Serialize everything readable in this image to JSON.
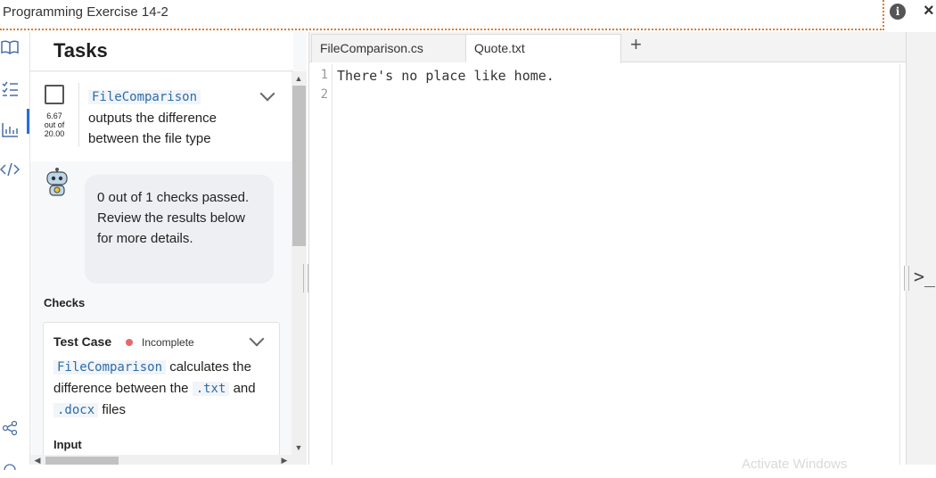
{
  "window": {
    "title": "Programming Exercise 14-2",
    "info_icon": "i",
    "close_icon": "×"
  },
  "rail": {
    "items": [
      {
        "name": "book-icon",
        "glyph": "📖"
      },
      {
        "name": "tasks-list-icon",
        "glyph": "☰"
      },
      {
        "name": "chart-icon",
        "glyph": "▥"
      },
      {
        "name": "code-icon",
        "glyph": "</>"
      },
      {
        "name": "share-icon",
        "glyph": "⋖"
      }
    ]
  },
  "tasks": {
    "title": "Tasks",
    "task": {
      "score_value": "6.67",
      "score_outof": "out of",
      "score_total": "20.00",
      "code": "FileComparison",
      "text": "outputs the difference between the file type"
    },
    "feedback": "0 out of 1 checks passed. Review the results below for more details.",
    "checks_label": "Checks",
    "test_case": {
      "title": "Test Case",
      "status": "Incomplete",
      "status_color": "#e86868",
      "code1": "FileComparison",
      "text1": "calculates the difference between the",
      "code2": ".txt",
      "text2": "and",
      "code3": ".docx",
      "text3": "files",
      "input_label": "Input"
    }
  },
  "editor": {
    "tabs": [
      {
        "label": "FileComparison.cs",
        "active": false
      },
      {
        "label": "Quote.txt",
        "active": true
      }
    ],
    "add_tab": "+",
    "lines": [
      {
        "num": "1",
        "text": "There's no place like home."
      },
      {
        "num": "2",
        "text": ""
      }
    ]
  },
  "terminal": {
    "icon": ">_"
  },
  "watermark": "Activate Windows"
}
